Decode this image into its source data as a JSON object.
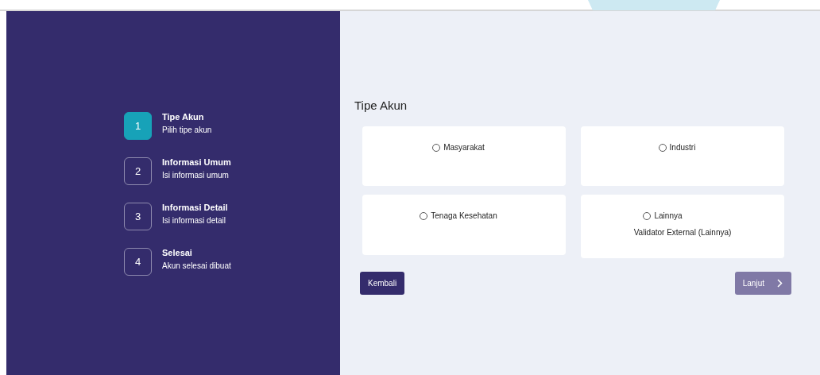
{
  "steps": [
    {
      "number": "1",
      "title": "Tipe Akun",
      "subtitle": "Pilih tipe akun",
      "active": true
    },
    {
      "number": "2",
      "title": "Informasi Umum",
      "subtitle": "Isi informasi umum",
      "active": false
    },
    {
      "number": "3",
      "title": "Informasi Detail",
      "subtitle": "Isi informasi detail",
      "active": false
    },
    {
      "number": "4",
      "title": "Selesai",
      "subtitle": "Akun selesai dibuat",
      "active": false
    }
  ],
  "form": {
    "title": "Tipe Akun",
    "options": [
      {
        "label": "Masyarakat",
        "selected": false
      },
      {
        "label": "Industri",
        "selected": false
      },
      {
        "label": "Tenaga Kesehatan",
        "selected": false
      },
      {
        "label": "Lainnya",
        "selected": false,
        "note": "Validator External (Lainnya)"
      }
    ],
    "back_button": {
      "label": "Kembali"
    },
    "next_button": {
      "label": "Lanjut",
      "disabled": true
    }
  }
}
